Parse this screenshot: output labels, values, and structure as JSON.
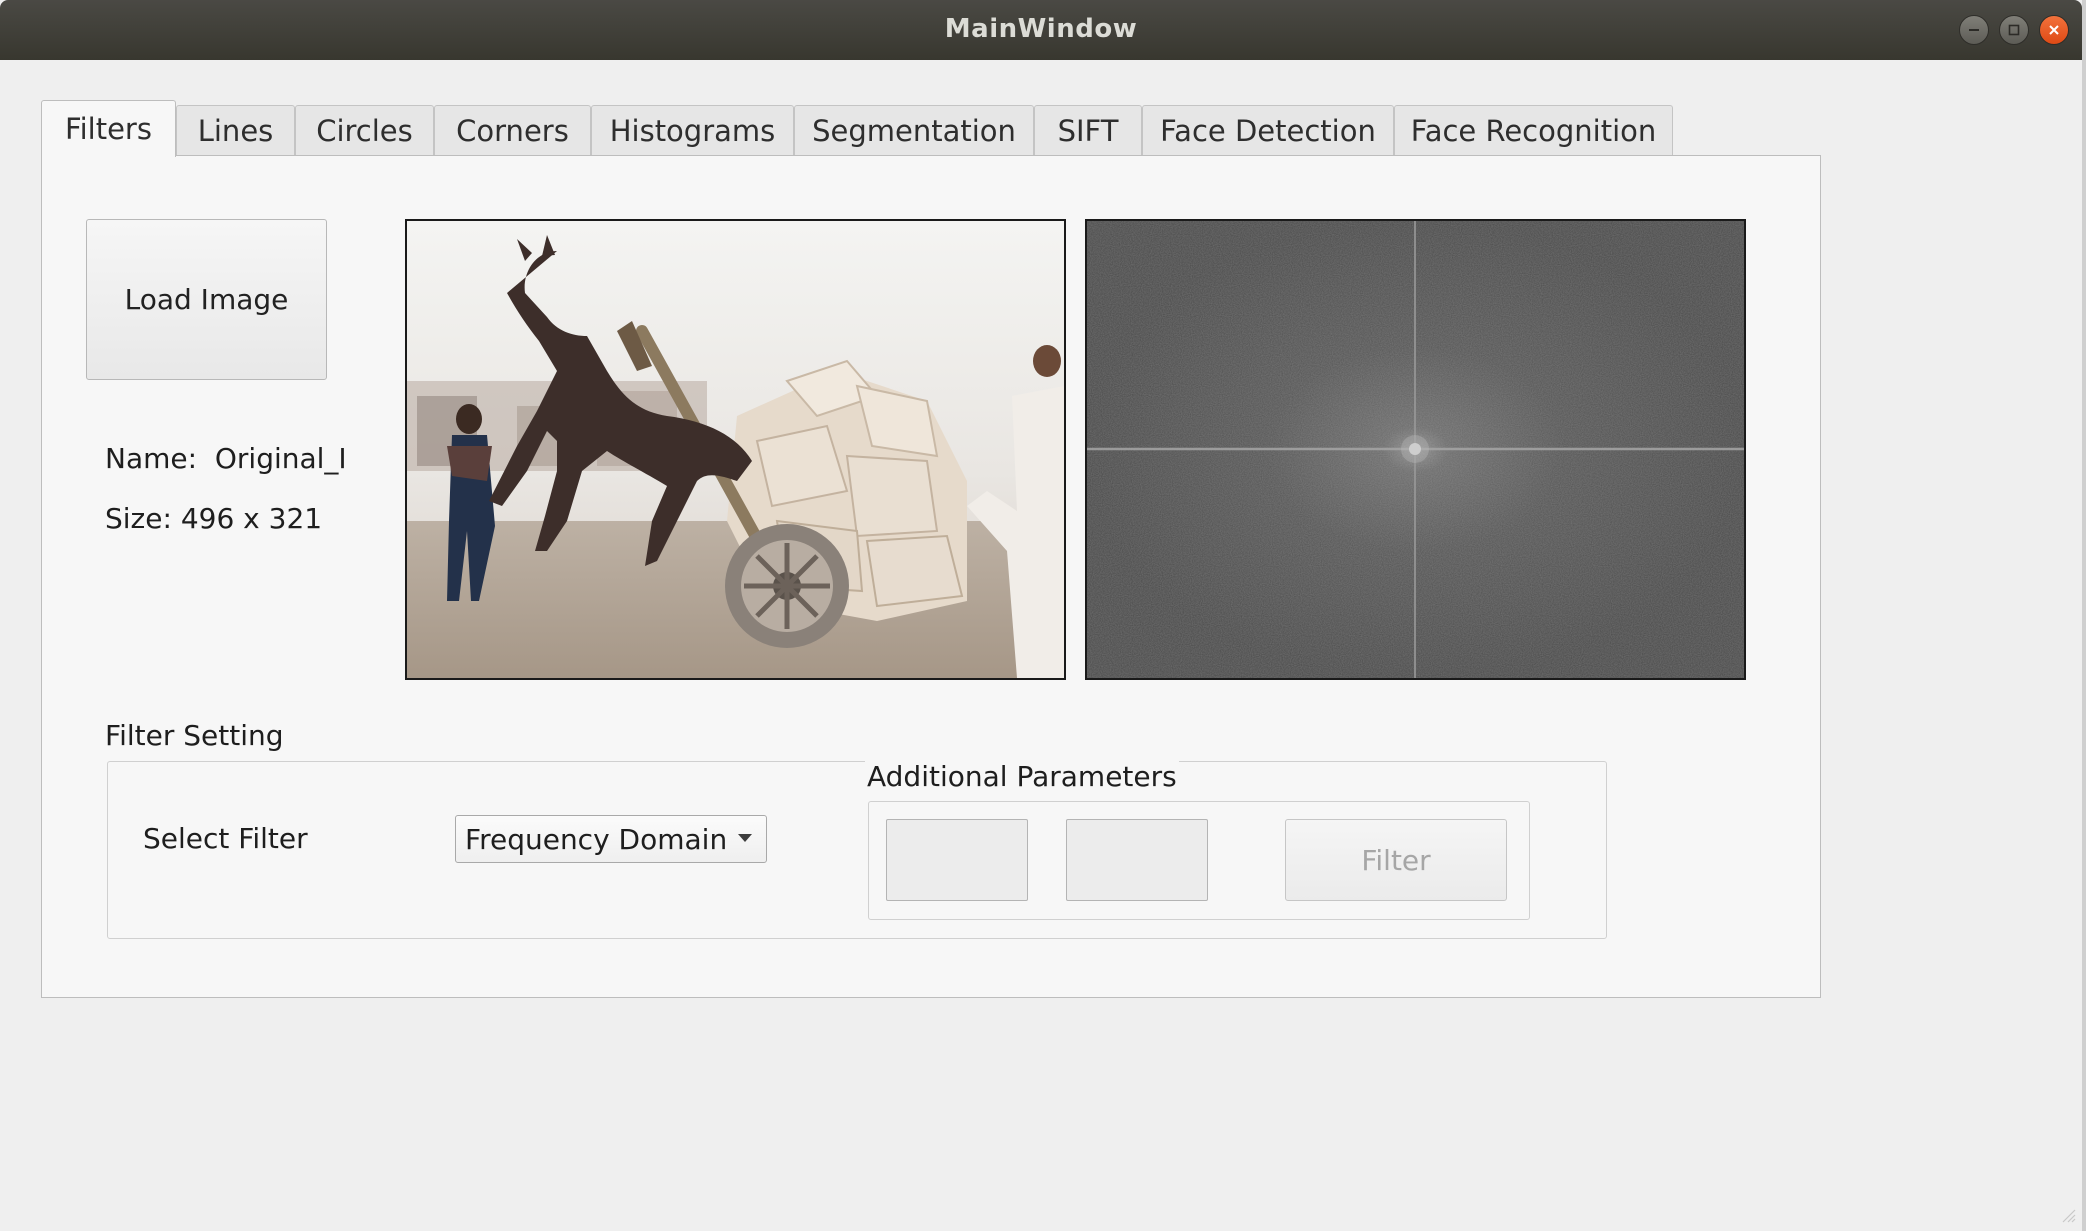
{
  "window": {
    "title": "MainWindow",
    "buttons": [
      "minimize",
      "maximize",
      "close"
    ]
  },
  "tabs": [
    {
      "label": "Filters",
      "active": true
    },
    {
      "label": "Lines",
      "active": false
    },
    {
      "label": "Circles",
      "active": false
    },
    {
      "label": "Corners",
      "active": false
    },
    {
      "label": "Histograms",
      "active": false
    },
    {
      "label": "Segmentation",
      "active": false
    },
    {
      "label": "SIFT",
      "active": false
    },
    {
      "label": "Face Detection",
      "active": false
    },
    {
      "label": "Face Recognition",
      "active": false
    }
  ],
  "filters_tab": {
    "load_button": "Load Image",
    "name_label": "Name:",
    "name_value": "Original_Ir",
    "size_label": "Size:",
    "size_value": "496 x 321",
    "original_image_icon": "photo-donkey-cart",
    "output_image_icon": "fft-magnitude-spectrum",
    "filter_setting": {
      "title": "Filter Setting",
      "select_label": "Select Filter",
      "select_value": "Frequency Domain",
      "additional_parameters_title": "Additional Parameters",
      "param1_value": "",
      "param2_value": "",
      "filter_button": "Filter",
      "filter_button_enabled": false
    }
  },
  "colors": {
    "titlebar": "#3e3d38",
    "close_button": "#e95420",
    "window_bg": "#efefef",
    "panel_bg": "#f7f7f7"
  }
}
